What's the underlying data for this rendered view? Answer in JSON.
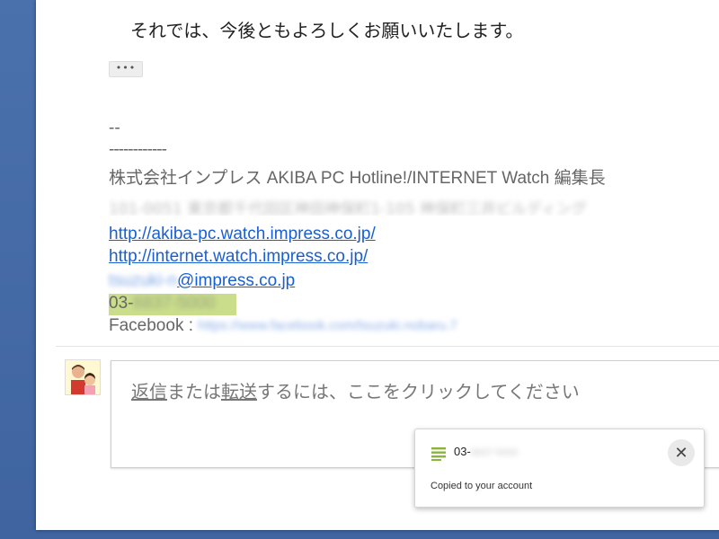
{
  "email": {
    "closing": "それでは、今後ともよろしくお願いいたします。",
    "ellipsis": "•••",
    "signature": {
      "dash_short": "--",
      "dash_long": "------------",
      "company": "株式会社インプレス AKIBA PC Hotline!/INTERNET Watch 編集長",
      "address_blurred": "101-0051 東京都千代田区神田神保町1-105 神保町三井ビルディング",
      "links": [
        "http://akiba-pc.watch.impress.co.jp/",
        "http://internet.watch.impress.co.jp/"
      ],
      "email_user_blurred": "tsuzuki-n",
      "email_domain": "@impress.co.jp",
      "phone_prefix": "03-",
      "phone_blurred": "6837-5000",
      "facebook_label": "Facebook :",
      "facebook_url_blurred": "https://www.facebook.com/tsuzuki.nobaru.7"
    }
  },
  "reply": {
    "link1": "返信",
    "mid": "または",
    "link2": "転送",
    "rest": "するには、ここをクリックしてください"
  },
  "toast": {
    "icon": "list-icon",
    "phone_prefix": "03-",
    "phone_blurred": "6837-5000",
    "close_icon": "close-icon",
    "close_glyph": "✕",
    "message": "Copied to your account",
    "accent": "#8ab33f"
  }
}
